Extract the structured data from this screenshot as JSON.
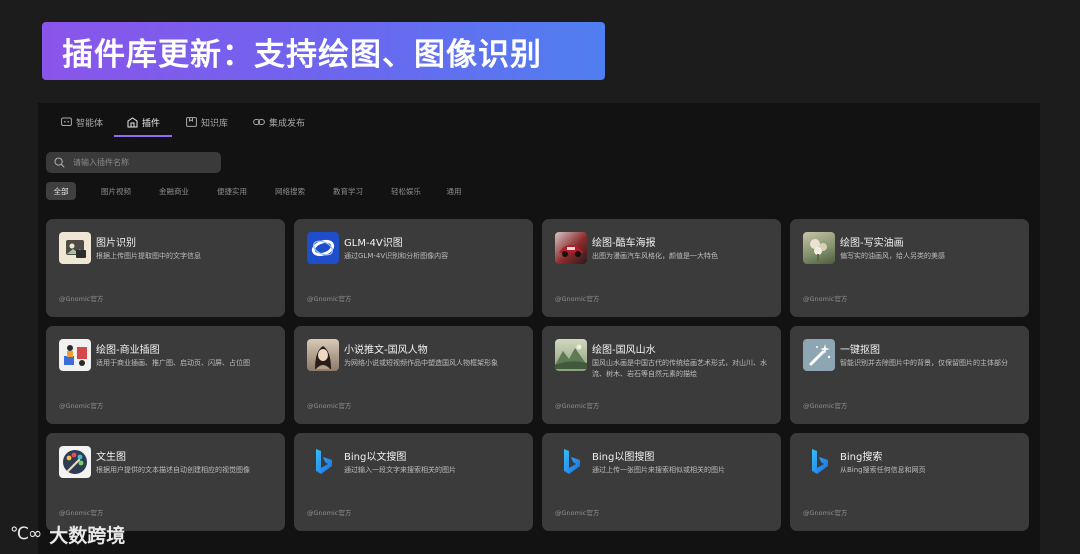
{
  "banner": {
    "title": "插件库更新：支持绘图、图像识别"
  },
  "tabs": [
    {
      "label": "智能体",
      "icon": "agent-icon"
    },
    {
      "label": "插件",
      "icon": "plugin-icon",
      "active": true
    },
    {
      "label": "知识库",
      "icon": "knowledge-icon"
    },
    {
      "label": "集成发布",
      "icon": "publish-icon"
    }
  ],
  "search": {
    "placeholder": "请输入插件名称"
  },
  "filters": [
    {
      "label": "全部",
      "active": true
    },
    {
      "label": "图片视频"
    },
    {
      "label": "金融商业"
    },
    {
      "label": "便捷实用"
    },
    {
      "label": "网络搜索"
    },
    {
      "label": "教育学习"
    },
    {
      "label": "轻松娱乐"
    },
    {
      "label": "通用"
    }
  ],
  "cards": [
    {
      "title": "图片识别",
      "desc": "根据上传图片提取图中的文字信息",
      "author": "@Gnomic官方",
      "icon": "image-recognition-icon"
    },
    {
      "title": "GLM-4V识图",
      "desc": "通过GLM-4V识别和分析图像内容",
      "author": "@Gnomic官方",
      "icon": "glm-4v-icon"
    },
    {
      "title": "绘图-酷车海报",
      "desc": "出图为漫画汽车风格化，颜值是一大特色",
      "author": "@Gnomic官方",
      "icon": "car-poster-thumbnail"
    },
    {
      "title": "绘图-写实油画",
      "desc": "偏写实的油画风，给人另类的美感",
      "author": "@Gnomic官方",
      "icon": "oil-painting-thumbnail"
    },
    {
      "title": "绘图-商业插图",
      "desc": "适用于商业插画、推广图、启动页、闪屏、占位图",
      "author": "@Gnomic官方",
      "icon": "business-illustration-icon"
    },
    {
      "title": "小说推文-国风人物",
      "desc": "为网络小说或短视频作品中塑造国风人物框架形象",
      "author": "@Gnomic官方",
      "icon": "guofeng-character-thumbnail"
    },
    {
      "title": "绘图-国风山水",
      "desc": "国风山水画是中国古代的传统绘画艺术形式，对山川、水流、树木、岩石等自然元素的描绘",
      "author": "@Gnomic官方",
      "icon": "landscape-painting-thumbnail"
    },
    {
      "title": "一键抠图",
      "desc": "智能识别并去除图片中的背景，仅保留图片的主体部分",
      "author": "@Gnomic官方",
      "icon": "magic-wand-icon"
    },
    {
      "title": "文生图",
      "desc": "根据用户提供的文本描述自动创建相应的视觉图像",
      "author": "@Gnomic官方",
      "icon": "palette-icon"
    },
    {
      "title": "Bing以文搜图",
      "desc": "通过输入一段文字来搜索相关的图片",
      "author": "@Gnomic官方",
      "icon": "bing-icon"
    },
    {
      "title": "Bing以图搜图",
      "desc": "通过上传一张图片来搜索相似或相关的图片",
      "author": "@Gnomic官方",
      "icon": "bing-icon"
    },
    {
      "title": "Bing搜索",
      "desc": "从Bing搜索任何信息和网页",
      "author": "@Gnomic官方",
      "icon": "bing-icon"
    }
  ],
  "watermark": {
    "logo": "℃∞",
    "text": "大数跨境"
  }
}
